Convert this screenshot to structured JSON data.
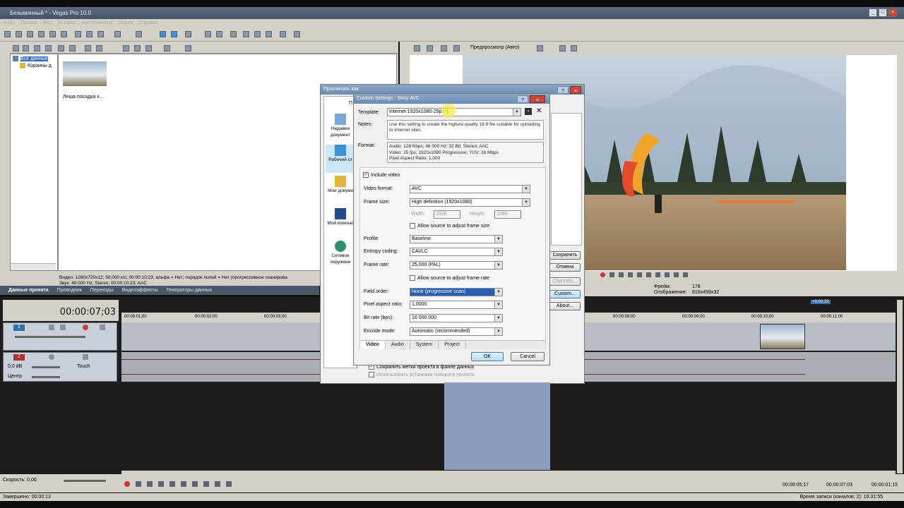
{
  "app": {
    "title": "Безымянный * - Vegas Pro 10.0"
  },
  "menu": [
    "Файл",
    "Правка",
    "Вид",
    "Вставка",
    "Инструменты",
    "Опции",
    "Справка"
  ],
  "explorer": {
    "tree": [
      "Все данные",
      "Корзины д"
    ],
    "media_label": "Леша посадка х...",
    "info_line1": "Видео: 1280x720x12; 50,000 к/с; 00:00:10;23; альфа = Нет; порядок полей = Нет (прогрессивное сканирова",
    "info_line2": "Звук: 48 000 Hz; Stereo; 00:00:10;23; AAC"
  },
  "bottom_tabs": [
    "Данные проекта",
    "Проводник",
    "Переходы",
    "Видеоэффекты",
    "Генераторы данных"
  ],
  "preview": {
    "mode": "Предпросмотр (Авто)",
    "frames_label": "Фрейм:",
    "frames_value": "178",
    "display_label": "Отображение:",
    "display_value": "816x459x32"
  },
  "timeline": {
    "timecode": "00:00:07;03",
    "marks": [
      "00:00:01;00",
      "00:00:02;00",
      "00:00:03;00",
      "00:00:08;00",
      "00:00:09;00",
      "00:00:10;00",
      "00:00:11;00"
    ],
    "marker": "+0:00:23",
    "track1_num": "1",
    "track2_num": "2",
    "track2_vol": "0,0 dB",
    "track2_touch": "Touch",
    "track2_pan": "Центр",
    "speed": "Скорость: 0,00",
    "tc_right1": "00:00:05;17",
    "tc_right2": "00:00:07;03",
    "tc_right3": "00:00:01;15"
  },
  "status": {
    "left": "Завершено: 00:00:13",
    "right": "Время записи (каналов: 2): 16:31:55"
  },
  "render_dialog": {
    "title": "Просчитать как",
    "places": [
      "Недавние документы",
      "Рабочий стол",
      "Мои документы",
      "Мой компьютер",
      "Сетевое окружение"
    ],
    "places_short": [
      "Недавни документ",
      "Рабочий ст",
      "Мои докуме",
      "Мой компью",
      "Сетевое окружени"
    ],
    "pane_letter": "П",
    "buttons": [
      "Сохранить",
      "Отмена",
      "Channels...",
      "Custom...",
      "About..."
    ],
    "check1": "Сохранить метки проекта в файле данных",
    "check2": "Использовать установки поворота проекта"
  },
  "custom_dialog": {
    "title": "Custom Settings - Sony AVC",
    "template_label": "Template:",
    "template_value": "Internet 1920x1080-25p (*)",
    "notes_label": "Notes:",
    "notes_value": "Use this setting to create the highest quality 16:9 file suitable for uploading to Internet sites.",
    "format_label": "Format:",
    "format_line1": "Audio: 128 Kbps; 48 000 Hz; 32 Bit; Stereo; AAC",
    "format_line2": "Video: 25 fps; 1920x1080 Progressive; YUV; 16 Mbps",
    "format_line3": "Pixel Aspect Ratio: 1,000",
    "include_video": "Include video",
    "video_format_label": "Video format:",
    "video_format": "AVC",
    "frame_size_label": "Frame size:",
    "frame_size": "High definition (1920x1080)",
    "width_label": "Width:",
    "width": "1920",
    "height_label": "Height:",
    "height": "1080",
    "allow_frame_size": "Allow source to adjust frame size",
    "profile_label": "Profile:",
    "profile": "Baseline",
    "entropy_label": "Entropy coding:",
    "entropy": "CAVLC",
    "frame_rate_label": "Frame rate:",
    "frame_rate": "25,000 (PAL)",
    "allow_frame_rate": "Allow source to adjust frame rate",
    "field_order_label": "Field order:",
    "field_order": "None (progressive scan)",
    "par_label": "Pixel aspect ratio:",
    "par": "1,0000",
    "bitrate_label": "Bit rate (bps):",
    "bitrate": "16 000 000",
    "encode_label": "Encode mode:",
    "encode": "Automatic (recommended)",
    "tabs": [
      "Video",
      "Audio",
      "System",
      "Project"
    ],
    "ok": "OK",
    "cancel": "Cancel"
  }
}
